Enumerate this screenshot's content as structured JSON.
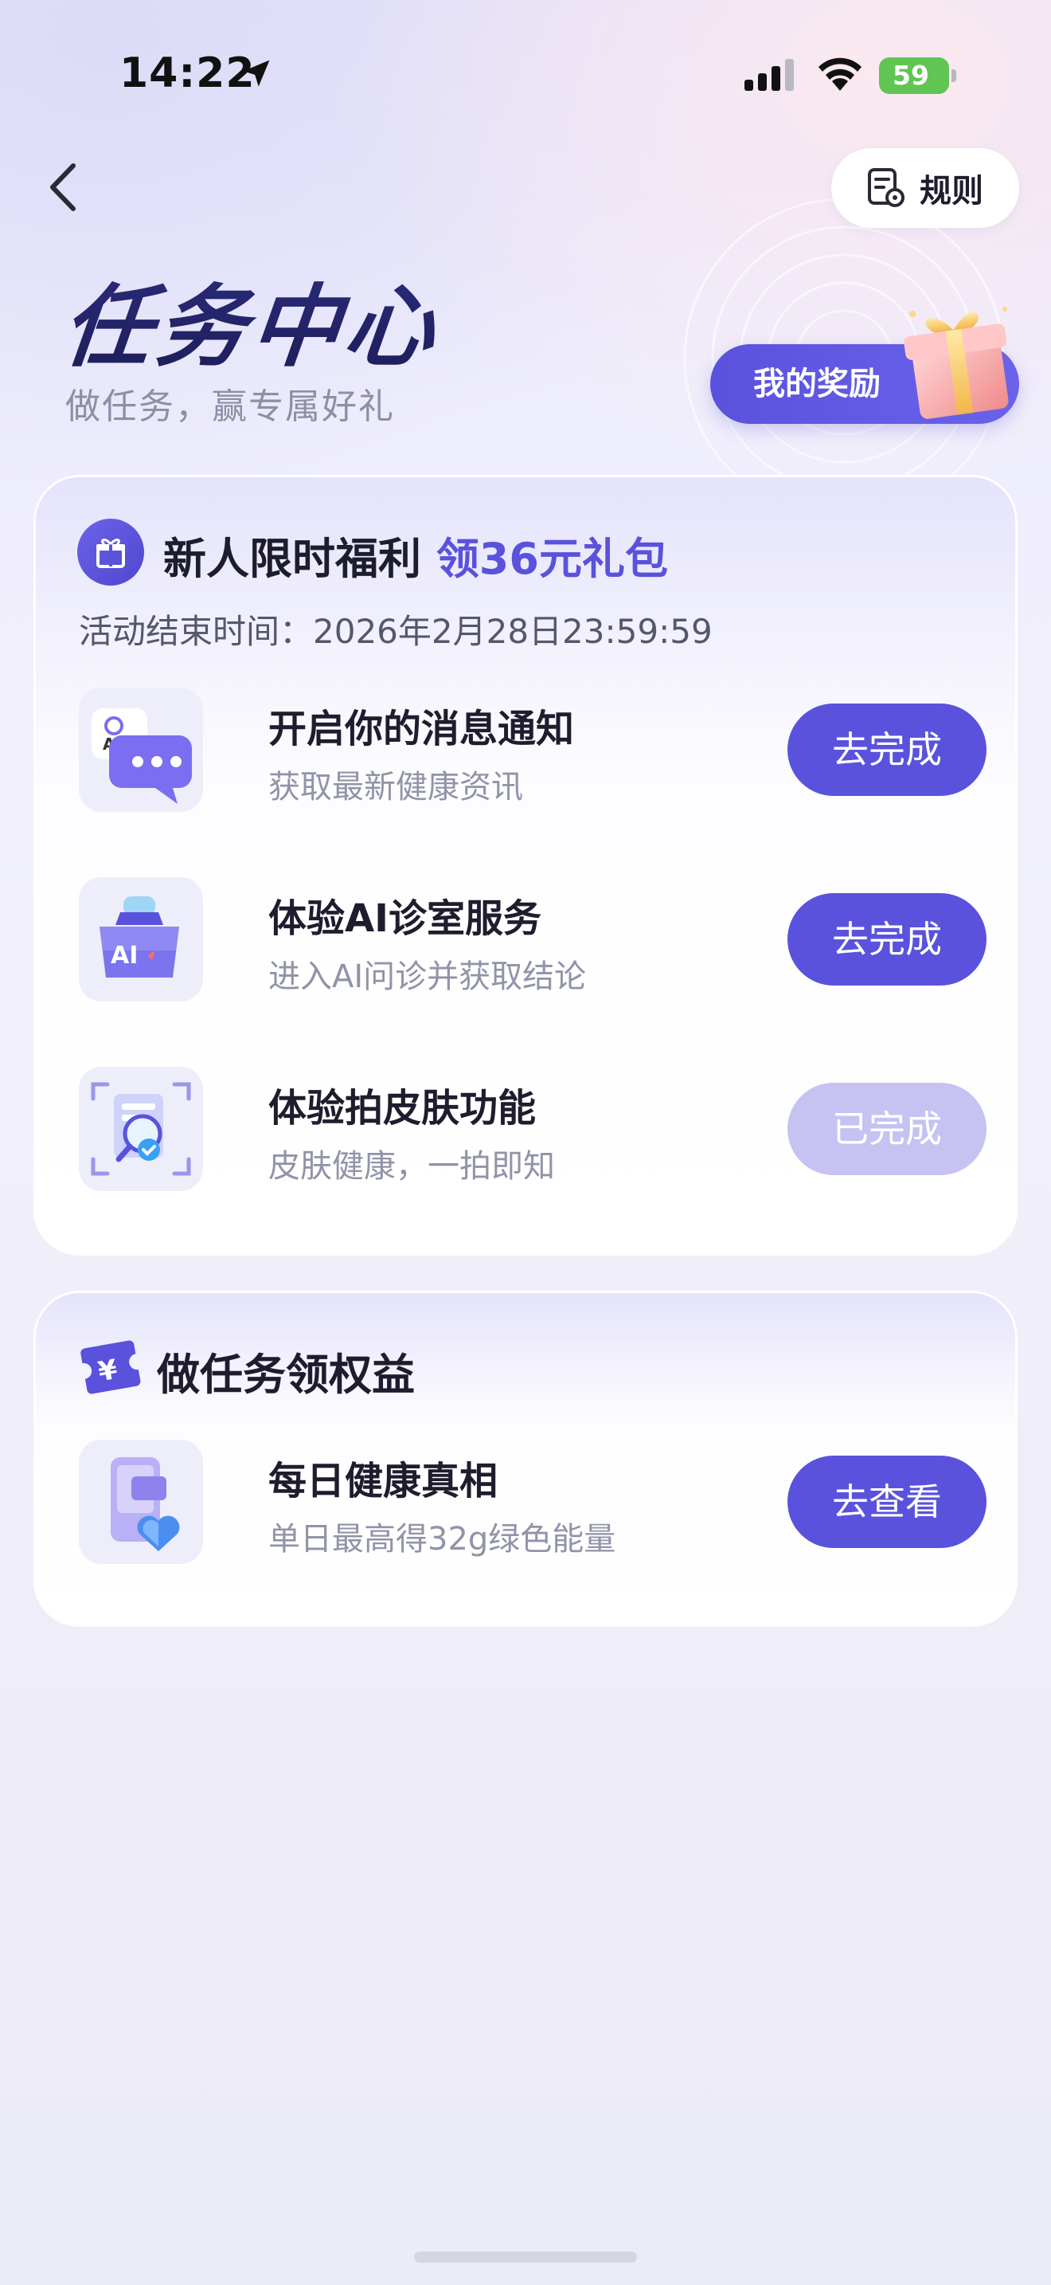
{
  "status_bar": {
    "time": "14:22",
    "battery": "59",
    "icons": [
      "location-arrow-icon",
      "cellular-signal-icon",
      "wifi-icon",
      "battery-charging-icon"
    ]
  },
  "header": {
    "rules_label": "规则",
    "title": "任务中心",
    "subtitle": "做任务，赢专属好礼",
    "rewards_label": "我的奖励"
  },
  "newcomer_card": {
    "title_main": "新人限时福利",
    "title_accent": "领36元礼包",
    "deadline": "活动结束时间：2026年2月28日23:59:59",
    "tasks": [
      {
        "title": "开启你的消息通知",
        "desc": "获取最新健康资讯",
        "button": "去完成",
        "done": false
      },
      {
        "title": "体验AI诊室服务",
        "desc": "进入AI问诊并获取结论",
        "button": "去完成",
        "done": false
      },
      {
        "title": "体验拍皮肤功能",
        "desc": "皮肤健康，一拍即知",
        "button": "已完成",
        "done": true
      }
    ]
  },
  "benefits_card": {
    "title": "做任务领权益",
    "tasks": [
      {
        "title": "每日健康真相",
        "desc": "单日最高得32g绿色能量",
        "button": "去查看"
      }
    ]
  },
  "colors": {
    "accent": "#5a52dd",
    "done_button": "#c6c3f2",
    "title_navy": "#23236b",
    "battery_green": "#61c554"
  }
}
